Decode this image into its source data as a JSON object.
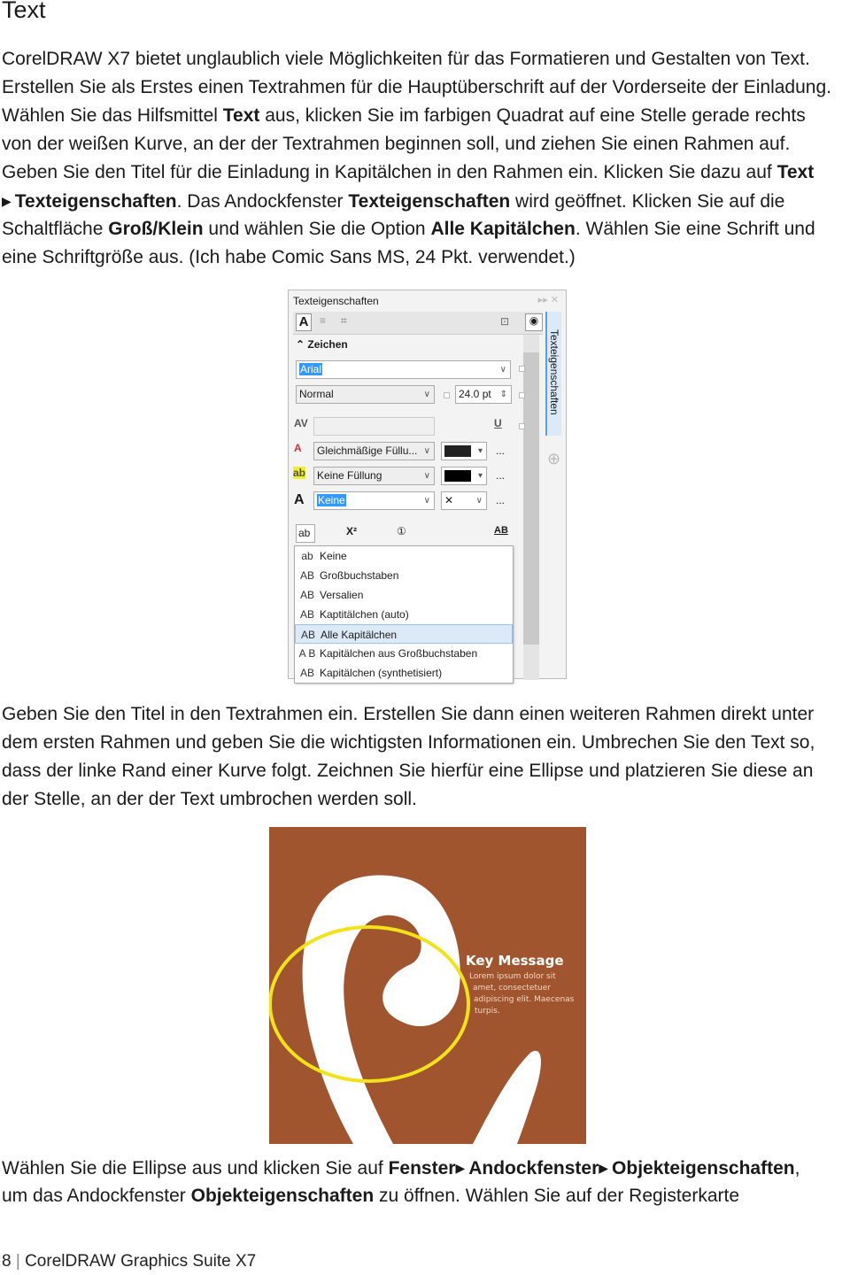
{
  "heading": "Text",
  "paragraphs": [
    [
      [
        {
          "t": "CorelDRAW X7 bietet unglaublich viele Möglichkeiten für das Formatieren und Gestalten von Text."
        }
      ],
      [
        {
          "t": "Erstellen Sie als Erstes einen Textrahmen für die Hauptüberschrift auf der Vorderseite der Einladung."
        }
      ],
      [
        {
          "t": "Wählen Sie das Hilfsmittel "
        },
        {
          "t": "Text",
          "b": true
        },
        {
          "t": " aus, klicken Sie im farbigen Quadrat auf eine Stelle gerade rechts"
        }
      ],
      [
        {
          "t": "von der weißen Kurve, an der der Textrahmen beginnen soll, und ziehen Sie einen Rahmen auf."
        }
      ],
      [
        {
          "t": "Geben Sie den Titel für die Einladung in Kapitälchen in den Rahmen ein. Klicken Sie dazu auf "
        },
        {
          "t": "Text",
          "b": true
        }
      ],
      [
        {
          "t": "▶",
          "a": true
        },
        {
          "t": "Texteigenschaften",
          "b": true
        },
        {
          "t": ". Das Andockfenster "
        },
        {
          "t": "Texteigenschaften",
          "b": true
        },
        {
          "t": " wird geöffnet. Klicken Sie auf die"
        }
      ],
      [
        {
          "t": "Schaltfläche "
        },
        {
          "t": "Groß/Klein",
          "b": true
        },
        {
          "t": " und wählen Sie die Option "
        },
        {
          "t": "Alle Kapitälchen",
          "b": true
        },
        {
          "t": ". Wählen Sie eine Schrift und"
        }
      ],
      [
        {
          "t": "eine Schriftgröße aus. (Ich habe Comic Sans MS, 24 Pkt. verwendet.)"
        }
      ]
    ],
    [
      [
        {
          "t": "Geben Sie den Titel in den Textrahmen ein. Erstellen Sie dann einen weiteren Rahmen direkt unter"
        }
      ],
      [
        {
          "t": "dem ersten Rahmen und geben Sie die wichtigsten Informationen ein. Umbrechen Sie den Text so,"
        }
      ],
      [
        {
          "t": "dass der linke Rand einer Kurve folgt. Zeichnen Sie hierfür eine Ellipse und platzieren Sie diese an"
        }
      ],
      [
        {
          "t": "der Stelle, an der der Text umbrochen werden soll."
        }
      ]
    ],
    [
      [
        {
          "t": "Wählen Sie die Ellipse aus und klicken Sie auf "
        },
        {
          "t": "Fenster",
          "b": true
        },
        {
          "t": "▶",
          "a": true
        },
        {
          "t": "Andockfenster",
          "b": true
        },
        {
          "t": "▶",
          "a": true
        },
        {
          "t": "Objekteigenschaften",
          "b": true
        },
        {
          "t": ","
        }
      ],
      [
        {
          "t": "um das Andockfenster "
        },
        {
          "t": "Objekteigenschaften",
          "b": true
        },
        {
          "t": " zu öffnen. Wählen Sie auf der Registerkarte"
        }
      ]
    ]
  ],
  "panel": {
    "title": "Texteigenschaften",
    "side_tab": "Texteigenschaften",
    "section": "Zeichen",
    "font": "Arial",
    "style": "Normal",
    "size": "24.0 pt",
    "fill": "Gleichmäßige Füllu...",
    "background_fill": "Keine Füllung",
    "outline": "Keine",
    "more": "...",
    "case_button": "ab",
    "menu": [
      {
        "icon": "ab",
        "label": "Keine"
      },
      {
        "icon": "AB",
        "label": "Großbuchstaben"
      },
      {
        "icon": "AB",
        "label": "Versalien"
      },
      {
        "icon": "AB",
        "label": "Kaptitälchen (auto)"
      },
      {
        "icon": "AB",
        "label": "Alle Kapitälchen",
        "selected": true
      },
      {
        "icon": "A B",
        "label": "Kapitälchen aus Großbuchstaben"
      },
      {
        "icon": "AB",
        "label": "Kapitälchen (synthetisiert)"
      }
    ]
  },
  "illustration": {
    "title": "Key Message",
    "body": [
      "Lorem ipsum dolor sit",
      "amet, consectetuer",
      "adipiscing elit. Maecenas",
      "turpis."
    ],
    "background": "#a0552f",
    "ellipse_color": "#f2e21a"
  },
  "footer": {
    "page": "8",
    "separator": "|",
    "title": "CorelDRAW Graphics Suite X7"
  }
}
